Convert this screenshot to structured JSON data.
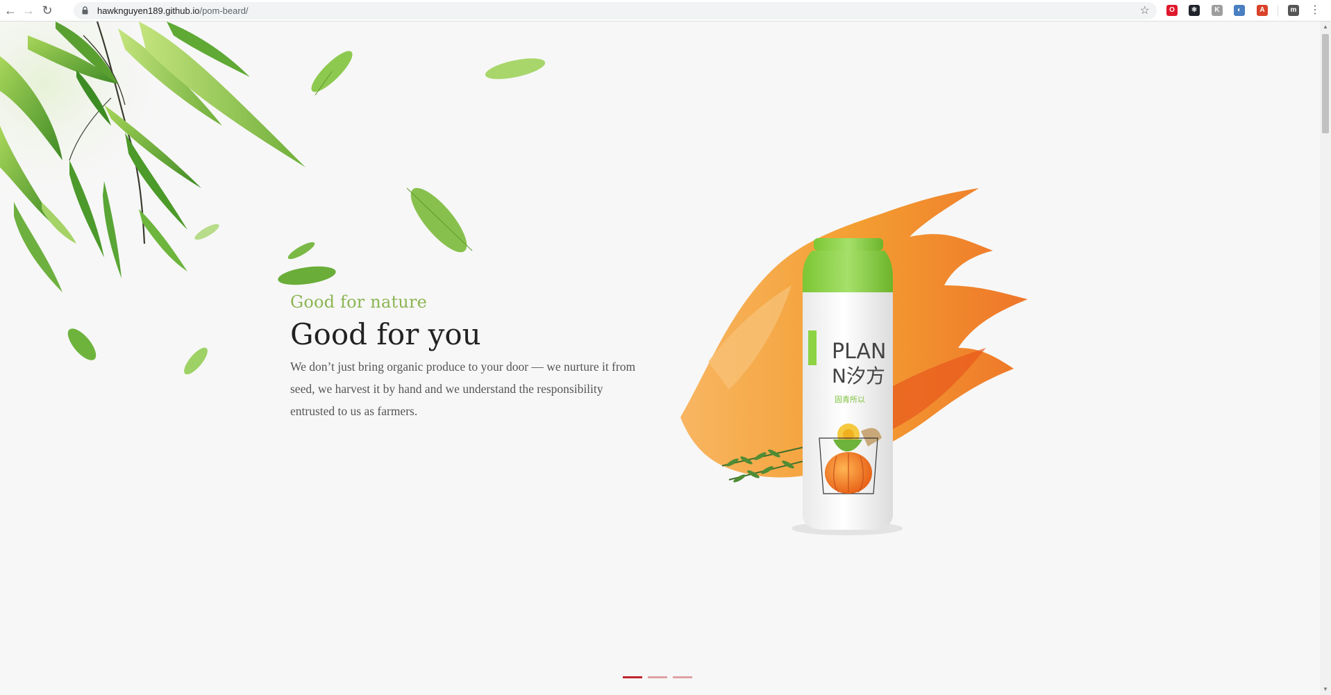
{
  "browser": {
    "url_host": "hawknguyen189.github.io",
    "url_path": "/pom-beard/",
    "nav": {
      "back_icon": "arrow-left-icon",
      "forward_icon": "arrow-right-icon",
      "reload_icon": "reload-icon"
    },
    "extensions": [
      {
        "name": "opera-extension-icon",
        "color": "#e0182d",
        "glyph": "O"
      },
      {
        "name": "react-devtools-icon",
        "color": "#20232a",
        "glyph": "⚛"
      },
      {
        "name": "k-extension-icon",
        "color": "#9e9e9e",
        "glyph": "K"
      },
      {
        "name": "compass-extension-icon",
        "color": "#4a7fc1",
        "glyph": "◐"
      },
      {
        "name": "adblock-extension-icon",
        "color": "#d9432a",
        "glyph": "A"
      },
      {
        "name": "meta-extension-icon",
        "color": "#555555",
        "glyph": "m"
      }
    ]
  },
  "hero": {
    "subtitle": "Good for nature",
    "title": "Good for you",
    "body": "We don’t just bring organic produce to your door — we nurture it from seed, we harvest it by hand and we understand the responsibility entrusted to us as farmers."
  },
  "product": {
    "brand_line_1": "PLAN",
    "brand_line_2": "N汐方",
    "tagline": "固青所以",
    "image_name": "juice-bottle-image"
  },
  "slider": {
    "count": 3,
    "active_index": 0
  },
  "colors": {
    "accent_green": "#8cb552",
    "slider_active": "#c0242d",
    "slider_inactive": "#e0a0a6",
    "bottle_green": "#8ed344",
    "splash_orange": "#f39a28"
  }
}
